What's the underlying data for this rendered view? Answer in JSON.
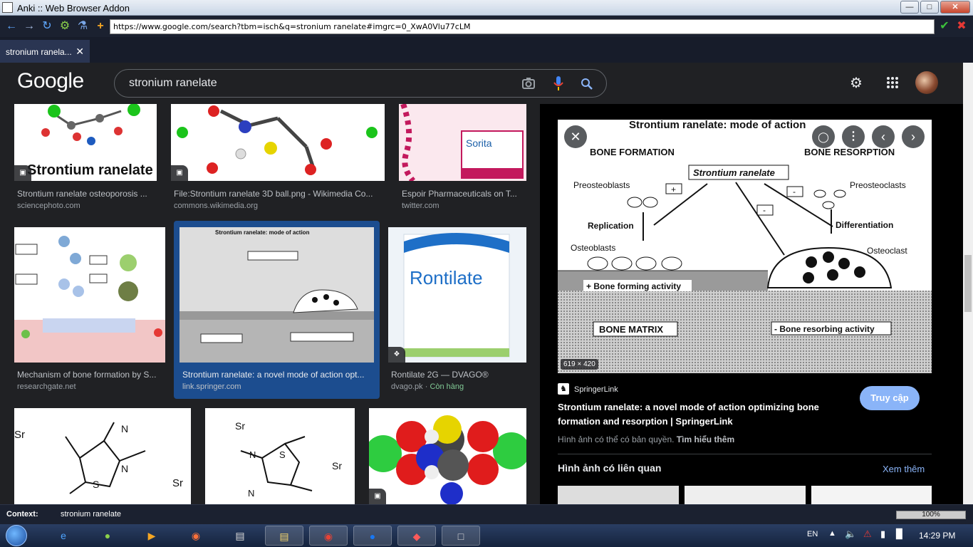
{
  "window": {
    "title": "Anki :: Web Browser Addon"
  },
  "browser": {
    "url": "https://www.google.com/search?tbm=isch&q=stronium ranelate#imgrc=0_XwA0Vlu77cLM",
    "tab_label": "stronium ranela..."
  },
  "google": {
    "logo": "Google",
    "query": "stronium ranelate"
  },
  "results": [
    {
      "title": "Strontium ranelate osteoporosis ...",
      "source": "sciencephoto.com",
      "thumb_text": "Strontium ranelate"
    },
    {
      "title": "File:Strontium ranelate 3D ball.png - Wikimedia Co...",
      "source": "commons.wikimedia.org"
    },
    {
      "title": "Espoir Pharmaceuticals on T...",
      "source": "twitter.com",
      "thumb_text": "Sorita"
    },
    {
      "title": "Mechanism of bone formation by S...",
      "source": "researchgate.net"
    },
    {
      "title": "Strontium ranelate: a novel mode of action opt...",
      "source": "link.springer.com"
    },
    {
      "title": "Rontilate 2G — DVAGO®",
      "source": "dvago.pk",
      "extra": "Còn hàng",
      "thumb_text": "Rontilate"
    }
  ],
  "preview": {
    "image_title": "Strontium ranelate: mode of action",
    "labels": {
      "bone_formation": "BONE FORMATION",
      "bone_resorption": "BONE RESORPTION",
      "center": "Strontium ranelate",
      "preosteoblasts": "Preosteoblasts",
      "preosteoclasts": "Preosteoclasts",
      "replication": "Replication",
      "differentiation": "Differentiation",
      "osteoblasts": "Osteoblasts",
      "osteoclast": "Osteoclast",
      "bone_forming": "+ Bone forming activity",
      "bone_matrix": "BONE MATRIX",
      "bone_resorbing": "- Bone resorbing activity"
    },
    "dimensions": "619 × 420",
    "site": "SpringerLink",
    "visit": "Truy cập",
    "title": "Strontium ranelate: a novel mode of action optimizing bone formation and resorption | SpringerLink",
    "copyright": "Hình ảnh có thể có bản quyền.",
    "learn_more": "Tìm hiểu thêm",
    "related_heading": "Hình ảnh có liên quan",
    "see_more": "Xem thêm"
  },
  "status": {
    "context_label": "Context:",
    "context_value": "stronium ranelate",
    "zoom": "100%"
  },
  "taskbar": {
    "lang": "EN",
    "time": "14:29 PM"
  }
}
